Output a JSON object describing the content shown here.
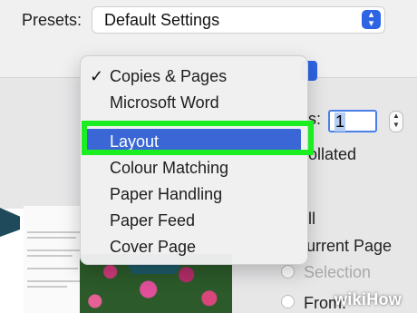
{
  "presets": {
    "label": "Presets:",
    "value": "Default Settings"
  },
  "copies": {
    "label_fragment": "s:",
    "value": "1"
  },
  "collated": {
    "label_fragment": "ollated"
  },
  "pages": {
    "all_fragment": "ll",
    "current_fragment": "urrent Page",
    "selection": "Selection",
    "from": "From:"
  },
  "menu": {
    "items": [
      {
        "label": "Copies & Pages",
        "checked": true
      },
      {
        "label": "Microsoft Word",
        "checked": false
      },
      {
        "label": "Layout",
        "selected": true
      },
      {
        "label": "Colour Matching"
      },
      {
        "label": "Paper Handling"
      },
      {
        "label": "Paper Feed"
      },
      {
        "label": "Cover Page"
      }
    ],
    "check_glyph": "✓"
  },
  "watermark": {
    "text": "wikiHow"
  },
  "colors": {
    "accent": "#3b67d6",
    "highlight": "#1bee20",
    "stepper": "#2d64e4"
  }
}
